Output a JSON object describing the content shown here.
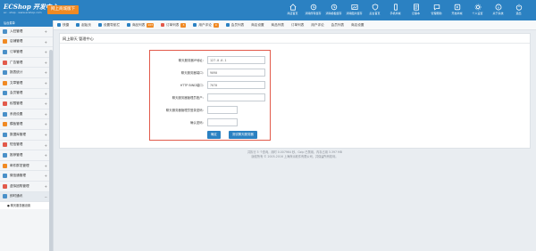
{
  "header": {
    "logo": "ECShop 开发中心",
    "logo_sub": "ec · shop · www.ecshop.com",
    "feature_button": "网上商城版下",
    "nav": [
      {
        "icon": "home-icon",
        "label": "商店首页"
      },
      {
        "icon": "cache-icon",
        "label": "清除所有缓存"
      },
      {
        "icon": "cache-icon",
        "label": "清除模板缓存"
      },
      {
        "icon": "image-icon",
        "label": "清除图片缓存"
      },
      {
        "icon": "shield-icon",
        "label": "后台首页"
      },
      {
        "icon": "mobile-icon",
        "label": "手机商城"
      },
      {
        "icon": "note-icon",
        "label": "记事本"
      },
      {
        "icon": "help-icon",
        "label": "管理帮助"
      },
      {
        "icon": "app-icon",
        "label": "开启商城"
      },
      {
        "icon": "settings-icon",
        "label": "个人设置"
      },
      {
        "icon": "about-icon",
        "label": "关于系统"
      },
      {
        "icon": "logout-icon",
        "label": "退出"
      }
    ]
  },
  "tabs": [
    {
      "label": "快捷",
      "color": "#2b81c2",
      "badge": ""
    },
    {
      "label": "起始页",
      "color": "#2b81c2",
      "badge": ""
    },
    {
      "label": "设置导航栏",
      "color": "#2b81c2",
      "badge": ""
    },
    {
      "label": "商品列表",
      "color": "#2b81c2",
      "badge": "103"
    },
    {
      "label": "订单列表",
      "color": "#e25a4b",
      "badge": "3"
    },
    {
      "label": "用户评论",
      "color": "#2b81c2",
      "badge": "0"
    },
    {
      "label": "会员列表",
      "color": "#2b81c2",
      "badge": ""
    },
    {
      "label": "商店设置",
      "color": "",
      "badge": ""
    },
    {
      "label": "商品列表",
      "color": "",
      "badge": ""
    },
    {
      "label": "订单列表",
      "color": "",
      "badge": ""
    },
    {
      "label": "用户评论",
      "color": "",
      "badge": ""
    },
    {
      "label": "会员列表",
      "color": "",
      "badge": ""
    },
    {
      "label": "商店设置",
      "color": "",
      "badge": ""
    }
  ],
  "sidebar": {
    "head": "后台菜单",
    "items": [
      {
        "label": "入驻管理",
        "color": "#4a90c8"
      },
      {
        "label": "店铺管理",
        "color": "#f08a24"
      },
      {
        "label": "订单管理",
        "color": "#4a90c8"
      },
      {
        "label": "广告管理",
        "color": "#e25a4b"
      },
      {
        "label": "报表统计",
        "color": "#4a90c8"
      },
      {
        "label": "文章管理",
        "color": "#f08a24"
      },
      {
        "label": "会员管理",
        "color": "#4a90c8"
      },
      {
        "label": "权限管理",
        "color": "#e25a4b"
      },
      {
        "label": "系统设置",
        "color": "#4a90c8"
      },
      {
        "label": "模板管理",
        "color": "#f08a24"
      },
      {
        "label": "数据库管理",
        "color": "#4a90c8"
      },
      {
        "label": "短信管理",
        "color": "#e25a4b"
      },
      {
        "label": "推荐管理",
        "color": "#4a90c8"
      },
      {
        "label": "邮件群发管理",
        "color": "#f08a24"
      },
      {
        "label": "微信通管理",
        "color": "#4a90c8"
      },
      {
        "label": "虚拟团购管理",
        "color": "#e25a4b"
      },
      {
        "label": "即时通讯",
        "color": "#4a90c8"
      }
    ],
    "sub_item": "● 聊天服务器设置"
  },
  "panel": {
    "title": "网上聊天 管理中心",
    "fields": [
      {
        "label": "聊天服务器IP地址：",
        "value": "127.0.0.1",
        "short": false
      },
      {
        "label": "聊天服务器端口：",
        "value": "9090",
        "short": false
      },
      {
        "label": "HTTP BIND端口：",
        "value": "7070",
        "short": false
      },
      {
        "label": "聊天服务器管理员账户：",
        "value": "",
        "short": false
      },
      {
        "label": "聊天服务器管理员登录密码：",
        "value": "",
        "short": true
      },
      {
        "label": "确认密码：",
        "value": "",
        "short": true
      }
    ],
    "submit_label": "确定",
    "test_label": "测试聊天服务器"
  },
  "footer": {
    "line1": "共执行 3 个查询，用时 0.007964 秒，Gzip 已禁用，内存占用 3.397 MB",
    "line2": "版权所有 © 2005-2016 上海商派软件有限公司，并保留所有权利。"
  }
}
